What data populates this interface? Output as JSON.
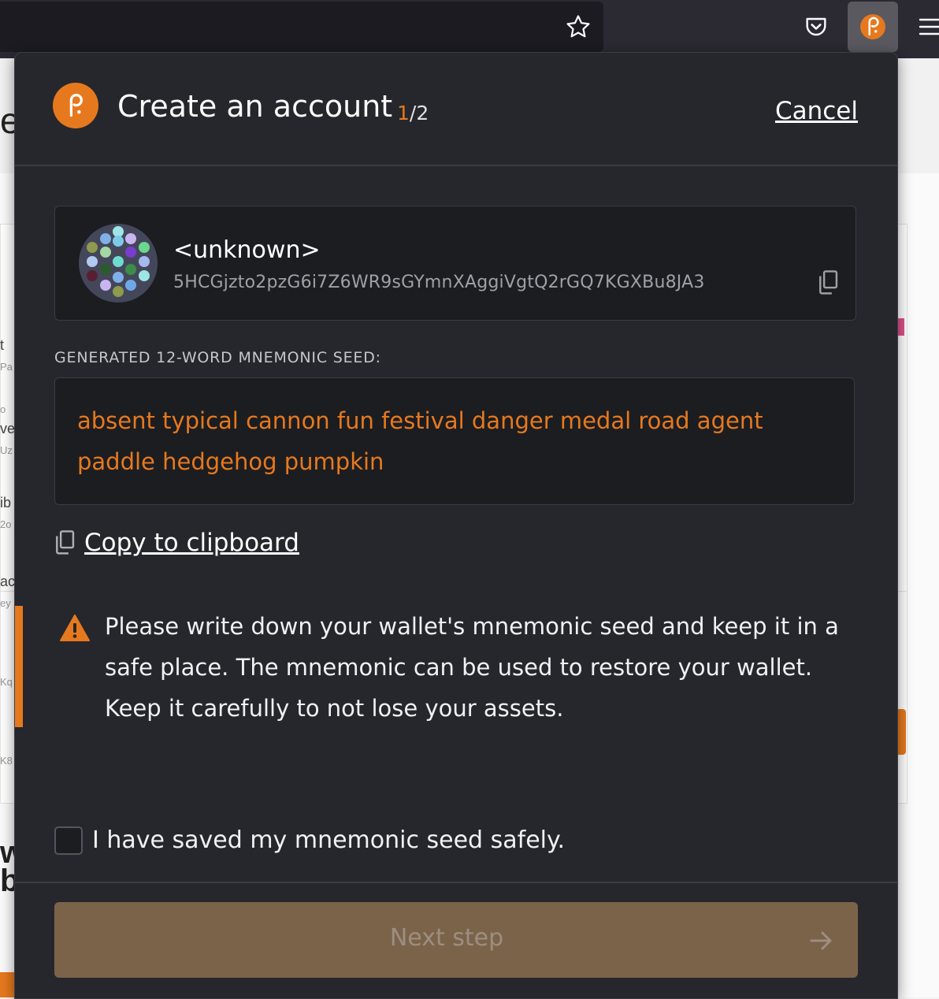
{
  "header": {
    "title": "Create an account",
    "step_current": "1",
    "step_total": "/2",
    "cancel_label": "Cancel"
  },
  "account": {
    "name": "<unknown>",
    "address": "5HCGjzto2pzG6i7Z6WR9sGYmnXAggiVgtQ2rGQ7KGXBu8JA3"
  },
  "seed": {
    "label": "GENERATED 12-WORD MNEMONIC SEED:",
    "phrase": "absent typical cannon fun festival danger medal road agent paddle hedgehog pumpkin"
  },
  "copy_label": "Copy to clipboard",
  "warning": {
    "text": "Please write down your wallet's mnemonic seed and keep it in a safe place. The mnemonic can be used to restore your wallet. Keep it carefully to not lose your assets."
  },
  "confirm": {
    "label": "I have saved my mnemonic seed safely.",
    "checked": false
  },
  "next_button": {
    "label": "Next step",
    "enabled": false
  },
  "background_fragments": [
    "er",
    "t",
    "Pa",
    "o",
    "ve",
    "Uz",
    "ib",
    "2o",
    "ac",
    "ey",
    "Kq",
    "K8",
    "w",
    "bi"
  ],
  "icons": {
    "toolbar": [
      "star-icon",
      "pocket-icon",
      "polkadot-extension-icon",
      "hamburger-menu-icon"
    ],
    "popup": [
      "polkadot-logo-icon",
      "identicon",
      "copy-icon",
      "warning-icon",
      "arrow-right-icon"
    ]
  },
  "colors": {
    "accent": "#e6791e",
    "popup_bg": "#26272c",
    "card_bg": "#1c1d21",
    "button_disabled_bg": "#7b634a"
  }
}
